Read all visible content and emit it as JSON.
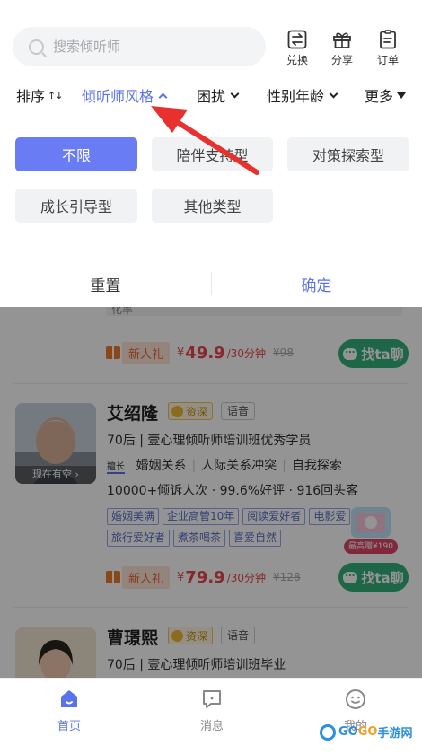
{
  "search": {
    "placeholder": "搜索倾听师"
  },
  "tools": {
    "exchange": "兑换",
    "share": "分享",
    "order": "订单"
  },
  "filters": {
    "sort": "排序",
    "style": "倾听师风格",
    "trouble": "困扰",
    "gender_age": "性别年龄",
    "more": "更多"
  },
  "style_options": [
    "不限",
    "陪伴支持型",
    "对策探索型",
    "成长引导型",
    "其他类型"
  ],
  "style_selected": "不限",
  "actions": {
    "reset": "重置",
    "confirm": "确定"
  },
  "prev_card": {
    "tail_text": "化率",
    "badge": "新人礼",
    "currency": "¥",
    "price": "49.9",
    "unit": "/30分钟",
    "original": "¥98",
    "chat": "找ta聊"
  },
  "cards": [
    {
      "name": "艾绍隆",
      "level": "资深",
      "mode": "语音",
      "online": "现在有空 ›",
      "bio": "70后 | 壹心理倾听师培训班优秀学员",
      "good_at_label": "擅长",
      "good_at": [
        "婚姻关系",
        "人际关系冲突",
        "自我探索"
      ],
      "stats": "10000+倾诉人次 · 99.6%好评 · 916回头客",
      "tags": [
        "婚姻美满",
        "企业高管10年",
        "阅读爱好者",
        "电影爱",
        "旅行爱好者",
        "煮茶喝茶",
        "喜爱自然"
      ],
      "badge": "新人礼",
      "currency": "¥",
      "price": "79.9",
      "unit": "/30分钟",
      "original": "¥128",
      "chat": "找ta聊"
    },
    {
      "name": "曹璟熙",
      "level": "资深",
      "mode": "语音",
      "bio": "70后 | 壹心理倾听师培训班毕业"
    }
  ],
  "promo": {
    "tip": "最高赠¥190"
  },
  "nav": {
    "home": "首页",
    "messages": "消息",
    "me": "我的"
  },
  "watermark": {
    "a": "GO",
    "b": "GO",
    "c": "手游网"
  },
  "colors": {
    "accent": "#5b73e8",
    "chip_active": "#6a7cf4",
    "price": "#e8474c",
    "chat": "#33b07a",
    "annotation_arrow": "#e8312f"
  }
}
